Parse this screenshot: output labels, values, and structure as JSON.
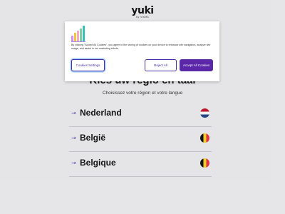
{
  "header": {
    "logo_word": "yuki",
    "logo_sub": "by VISMA"
  },
  "main": {
    "headline": "Kies uw regio en taal",
    "subline": "Choisissez votre région et votre langue",
    "countries": [
      {
        "label": "Nederland",
        "flag": "nl-flag-icon"
      },
      {
        "label": "België",
        "flag": "be-flag-icon"
      },
      {
        "label": "Belgique",
        "flag": "be-flag-icon"
      }
    ]
  },
  "cookie_dialog": {
    "text": "By clicking \"Accept All Cookies\", you agree to the storing of cookies on your device to enhance site navigation, analyze site usage, and assist in our marketing efforts.",
    "settings_label": "Cookies Settings",
    "reject_label": "Reject All",
    "accept_label": "Accept All Cookies",
    "logo_icon": "bar-chart-logo-icon"
  },
  "colors": {
    "accent": "#5b26a8",
    "outline": "#4a2fa6"
  }
}
